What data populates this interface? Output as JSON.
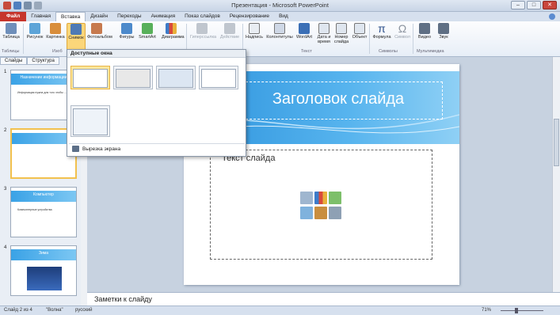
{
  "window": {
    "title": "Презентация - Microsoft PowerPoint"
  },
  "tabs": [
    "Файл",
    "Главная",
    "Вставка",
    "Дизайн",
    "Переходы",
    "Анимация",
    "Показ слайдов",
    "Рецензирование",
    "Вид"
  ],
  "active_tab": "Вставка",
  "ribbon": {
    "buttons": {
      "table": "Таблица",
      "picture": "Рисунок",
      "clipart": "Картинка",
      "screenshot": "Снимок",
      "photoalbum": "Фотоальбом",
      "shapes": "Фигуры",
      "smartart": "SmartArt",
      "chart": "Диаграмма",
      "hyperlink": "Гиперссылка",
      "action": "Действие",
      "textbox": "Надпись",
      "headerfooter": "Колонтитулы",
      "wordart": "WordArt",
      "datetime": "Дата и время",
      "slidenumber": "Номер слайда",
      "object": "Объект",
      "equation": "Формула",
      "symbol": "Символ",
      "video": "Видео",
      "audio": "Звук"
    },
    "groups": {
      "tables": "Таблицы",
      "images": "Изоб",
      "text": "Текст",
      "symbols": "Символы",
      "media": "Мультимедиа"
    }
  },
  "left_pane": {
    "tabs": [
      "Слайды",
      "Структура"
    ],
    "thumbnails": [
      {
        "num": "1",
        "title": "Назначение информации",
        "body": "Информация нужна для того чтобы ..."
      },
      {
        "num": "2",
        "title": "",
        "body": ""
      },
      {
        "num": "3",
        "title": "Компьютер",
        "body": "Компьютерные устройства"
      },
      {
        "num": "4",
        "title": "Зима",
        "body": ""
      }
    ]
  },
  "screenshot_dropdown": {
    "header": "Доступные окна",
    "windows_count": 5,
    "screen_clipping": "Вырезка экрана"
  },
  "slide": {
    "title": "Заголовок слайда",
    "body_placeholder": "Текст слайда"
  },
  "notes": {
    "placeholder": "Заметки к слайду"
  },
  "status": {
    "slide": "Слайд 2 из 4",
    "theme": "\"Волна\"",
    "language": "русский",
    "zoom": "71%"
  },
  "colors": {
    "accent_blue": "#2d93dd",
    "file_tab": "#c6352c",
    "selection": "#fbd67a"
  }
}
